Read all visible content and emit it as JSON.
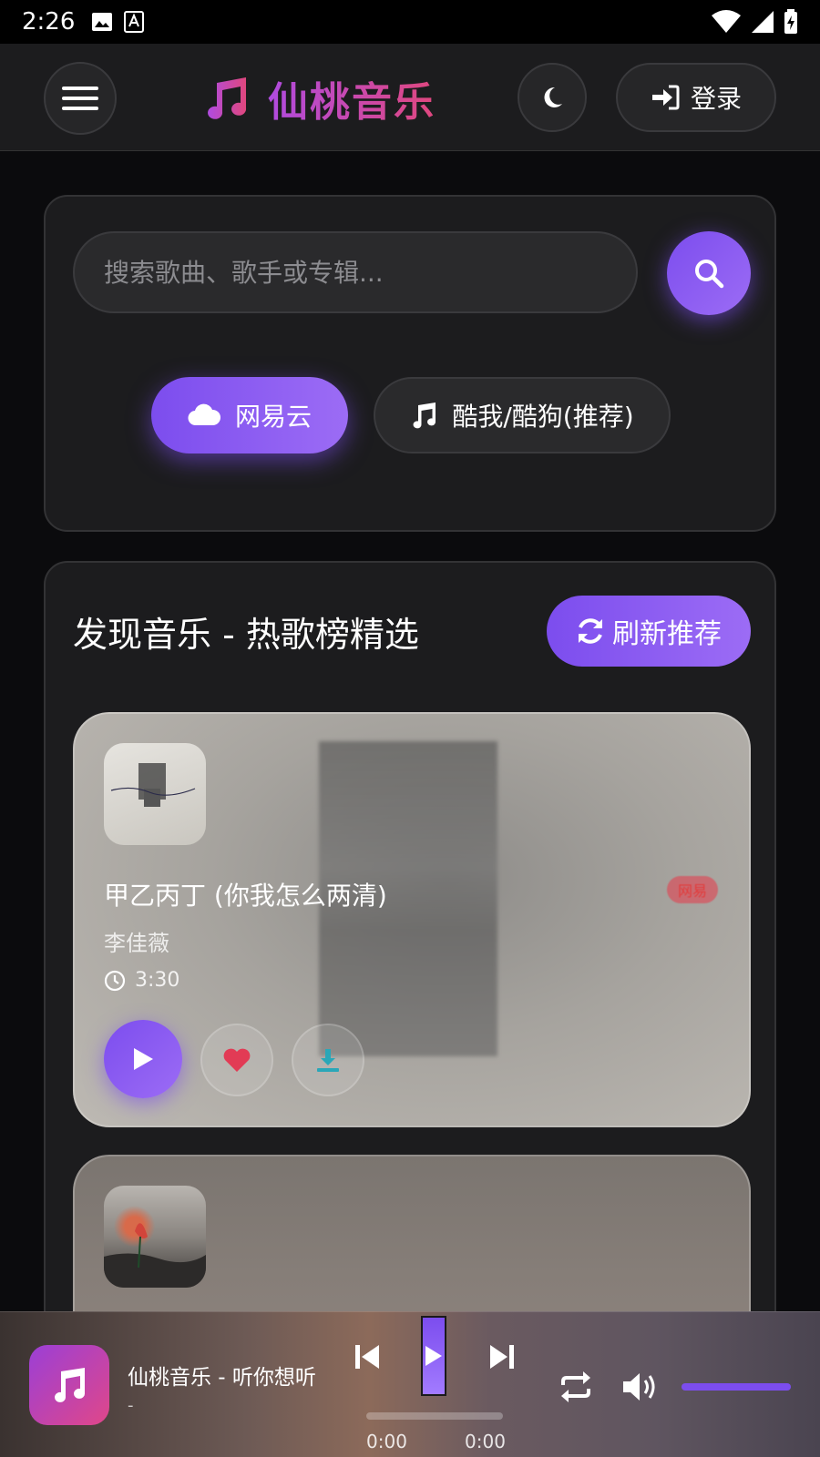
{
  "status_bar": {
    "time": "2:26"
  },
  "header": {
    "brand_name": "仙桃音乐",
    "login_label": "登录"
  },
  "search": {
    "placeholder": "搜索歌曲、歌手或专辑...",
    "sources": [
      {
        "label": "网易云",
        "active": true
      },
      {
        "label": "酷我/酷狗(推荐)",
        "active": false
      }
    ]
  },
  "discover": {
    "title": "发现音乐 - 热歌榜精选",
    "refresh_label": "刷新推荐",
    "songs": [
      {
        "title": "甲乙丙丁 (你我怎么两清)",
        "artist": "李佳薇",
        "duration": "3:30",
        "source_badge": "网易"
      },
      {
        "title": "",
        "artist": "",
        "duration": ""
      }
    ]
  },
  "player": {
    "title": "仙桃音乐 - 听你想听",
    "artist": "-",
    "current_time": "0:00",
    "total_time": "0:00",
    "progress": 0,
    "volume": 1.0
  },
  "colors": {
    "accent": "#7c4dee",
    "brand_gradient_start": "#b04be0",
    "brand_gradient_end": "#e0477e",
    "like": "#e23b55",
    "download": "#2aa7b8"
  }
}
